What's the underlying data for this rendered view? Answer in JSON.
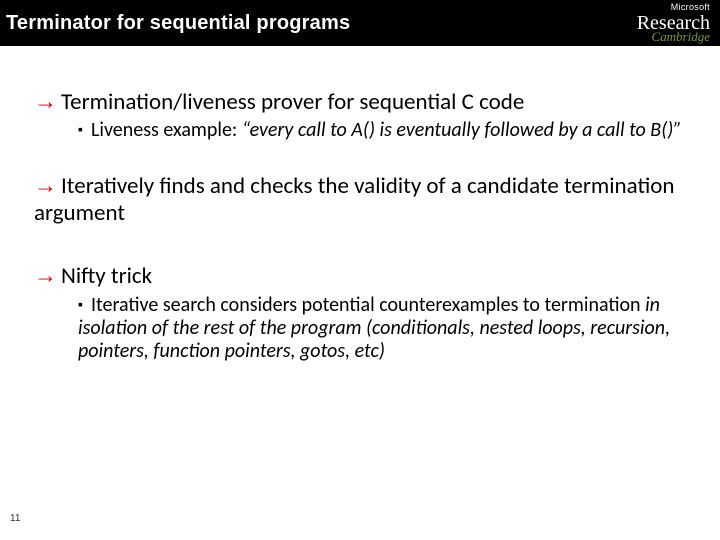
{
  "header": {
    "title": "Terminator for sequential programs",
    "logo": {
      "top": "Microsoft",
      "main": "Research",
      "sub": "Cambridge"
    }
  },
  "bullets": {
    "b1_1": "Termination/liveness prover for sequential C code",
    "b1_1_sub_prefix": "Liveness example: ",
    "b1_1_sub_quote": "“every call to A() is eventually followed by a call to B()”",
    "b1_2": "Iteratively finds and checks the validity of a candidate termination argument",
    "b1_3": "Nifty trick",
    "b1_3_sub_prefix": "Iterative search considers potential counterexamples to termination ",
    "b1_3_sub_italic": "in isolation of the rest of the program (conditionals, nested loops, recursion, pointers, function pointers, gotos, etc)"
  },
  "page_number": "11"
}
